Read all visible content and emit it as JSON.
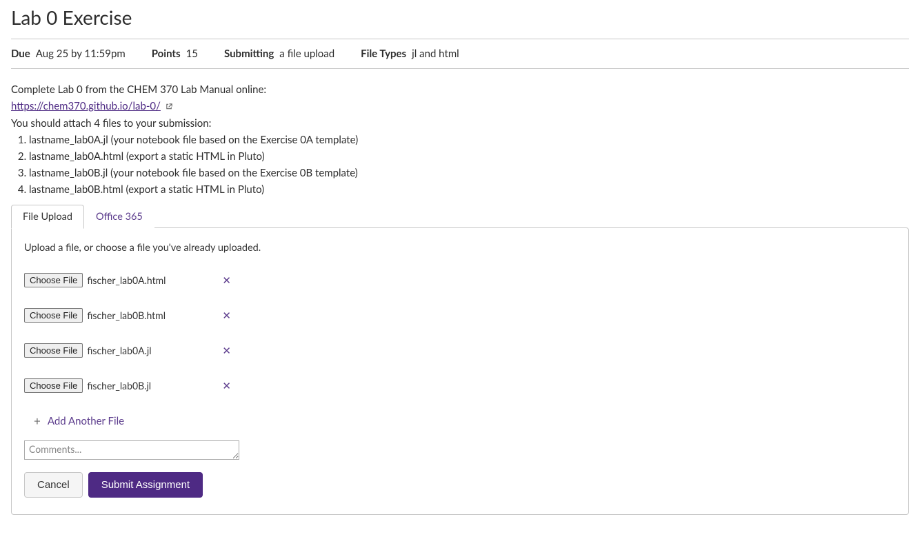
{
  "title": "Lab 0 Exercise",
  "meta": {
    "due_label": "Due",
    "due_value": "Aug 25 by 11:59pm",
    "points_label": "Points",
    "points_value": "15",
    "submitting_label": "Submitting",
    "submitting_value": "a file upload",
    "filetypes_label": "File Types",
    "filetypes_value": "jl and html"
  },
  "description": {
    "line1": "Complete Lab 0 from the CHEM 370 Lab Manual online:",
    "link_text": "https://chem370.github.io/lab-0/",
    "line2": "You should attach 4 files to your submission:",
    "items": [
      "lastname_lab0A.jl (your notebook file based on the Exercise 0A template)",
      "lastname_lab0A.html (export a static HTML in Pluto)",
      "lastname_lab0B.jl (your notebook file based on the Exercise 0B template)",
      "lastname_lab0B.html (export a static HTML in Pluto)"
    ]
  },
  "tabs": {
    "upload": "File Upload",
    "office": "Office 365"
  },
  "panel": {
    "hint": "Upload a file, or choose a file you've already uploaded.",
    "choose_label": "Choose File",
    "files": [
      "fischer_lab0A.html",
      "fischer_lab0B.html",
      "fischer_lab0A.jl",
      "fischer_lab0B.jl"
    ],
    "add_another": "Add Another File",
    "comments_placeholder": "Comments...",
    "cancel": "Cancel",
    "submit": "Submit Assignment"
  }
}
